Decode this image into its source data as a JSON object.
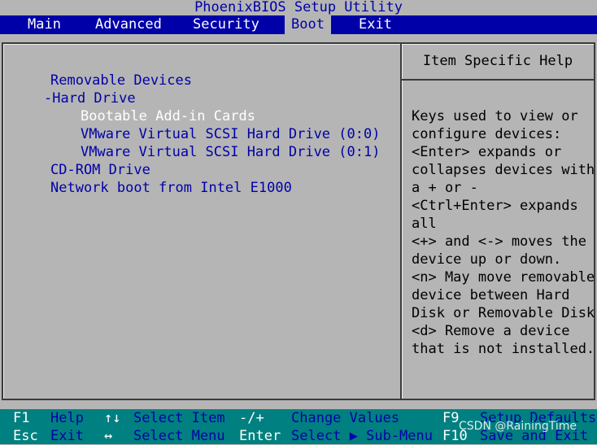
{
  "title": "PhoenixBIOS Setup Utility",
  "menu": [
    {
      "label": "Main",
      "active": false
    },
    {
      "label": "Advanced",
      "active": false
    },
    {
      "label": "Security",
      "active": false
    },
    {
      "label": "Boot",
      "active": true
    },
    {
      "label": "Exit",
      "active": false
    }
  ],
  "boot_items": [
    {
      "label": "Removable Devices",
      "level": 0,
      "selected": false
    },
    {
      "label": "-Hard Drive",
      "level": 0,
      "selected": false
    },
    {
      "label": "Bootable Add-in Cards",
      "level": 1,
      "selected": true
    },
    {
      "label": "VMware Virtual SCSI Hard Drive (0:0)",
      "level": 1,
      "selected": false
    },
    {
      "label": "VMware Virtual SCSI Hard Drive (0:1)",
      "level": 1,
      "selected": false
    },
    {
      "label": "CD-ROM Drive",
      "level": 0,
      "selected": false
    },
    {
      "label": "Network boot from Intel E1000",
      "level": 0,
      "selected": false
    }
  ],
  "help": {
    "title": "Item Specific Help",
    "lines": [
      "Keys used to view or",
      "configure devices:",
      "<Enter> expands or",
      "collapses devices with",
      "a + or -",
      "<Ctrl+Enter> expands",
      "all",
      "<+> and <-> moves the",
      "device up or down.",
      "<n> May move removable",
      "device between Hard",
      "Disk or Removable Disk",
      "<d> Remove a device",
      "that is not installed."
    ]
  },
  "status": {
    "row1": [
      {
        "key": "F1",
        "desc": "Help"
      },
      {
        "key": "↑↓",
        "desc": "Select Item"
      },
      {
        "key": "-/+",
        "desc": "Change Values"
      },
      {
        "key": "F9",
        "desc": "Setup Defaults"
      }
    ],
    "row2": [
      {
        "key": "Esc",
        "desc": "Exit"
      },
      {
        "key": "↔",
        "desc": "Select Menu"
      },
      {
        "key": "Enter",
        "desc": "Select ▶ Sub-Menu"
      },
      {
        "key": "F10",
        "desc": "Save and Exit"
      }
    ]
  },
  "watermark": "CSDN @RainingTime",
  "colors": {
    "background": "#b5b5b5",
    "menu_bar": "#0000a8",
    "status_bar": "#008080",
    "item_text": "#0000a8",
    "selected_text": "#ffffff"
  }
}
